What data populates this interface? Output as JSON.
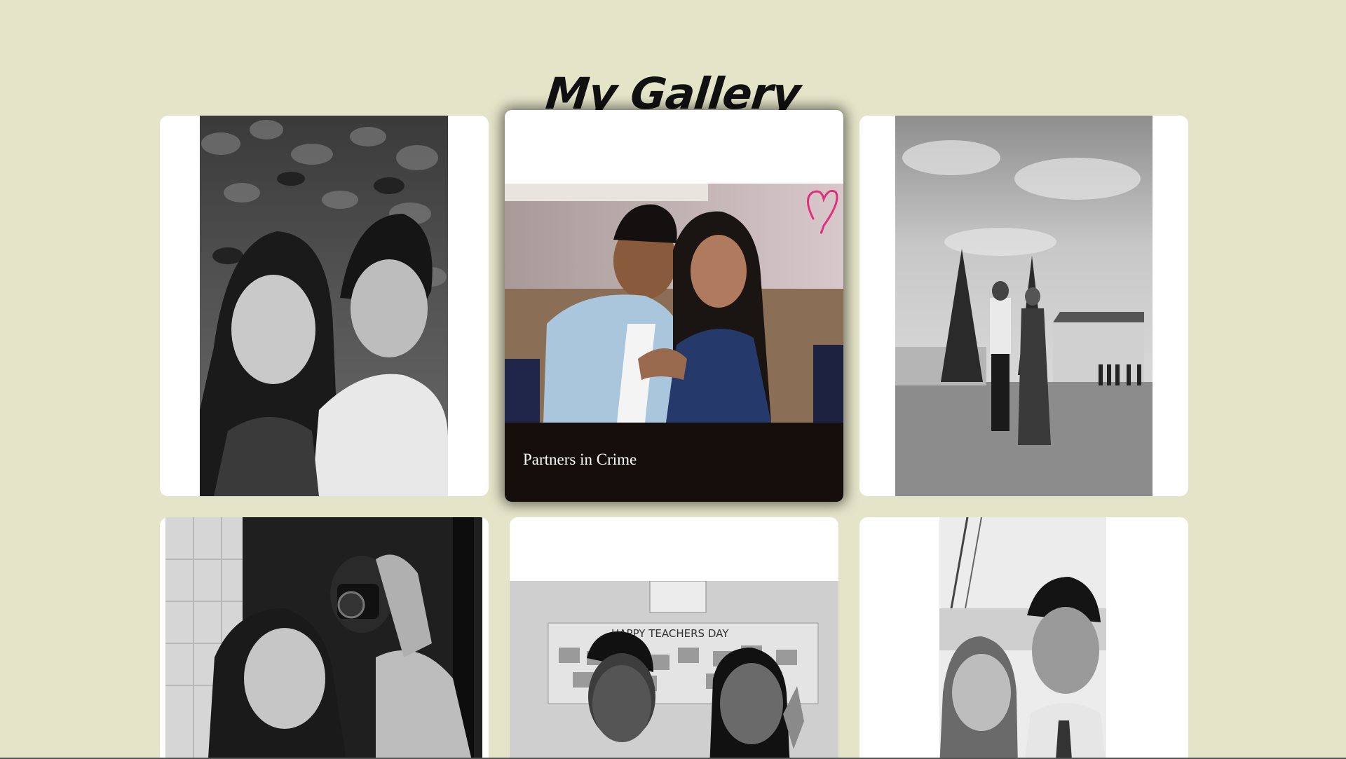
{
  "gallery": {
    "title": "My Gallery",
    "items": [
      {
        "caption": ""
      },
      {
        "caption": "Partners in Crime"
      },
      {
        "caption": ""
      },
      {
        "caption": ""
      },
      {
        "caption": "",
        "sign_text": "HAPPY TEACHERS DAY"
      },
      {
        "caption": ""
      }
    ]
  },
  "colors": {
    "background": "#e4e4c8",
    "card": "#ffffff",
    "caption_bar": "#150e0a",
    "heart": "#e0307a"
  }
}
